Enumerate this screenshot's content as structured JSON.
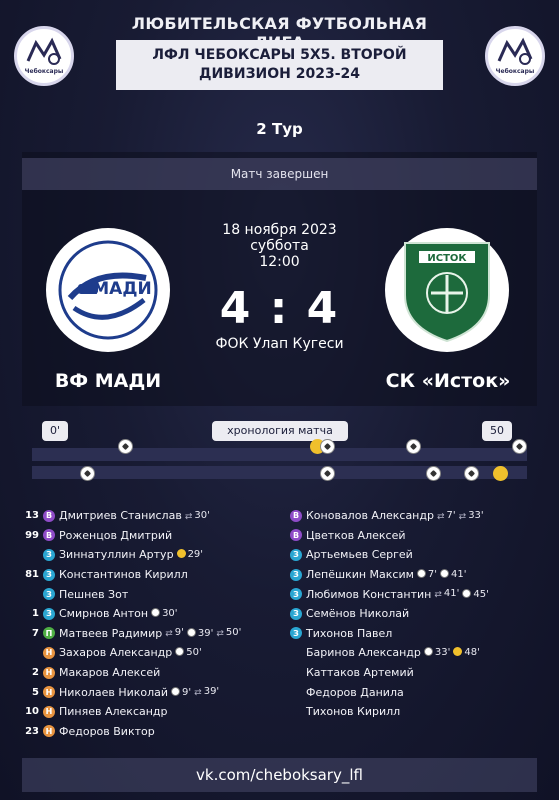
{
  "header": {
    "league_name": "ЛЮБИТЕЛЬСКАЯ ФУТБОЛЬНАЯ ЛИГА",
    "tournament_title": "ЛФЛ ЧЕБОКСАРЫ 5Х5. ВТОРОЙ ДИВИЗИОН 2023-24",
    "logo_city": "Чебоксары"
  },
  "round": "2 Тур",
  "match": {
    "status": "Матч завершен",
    "date": "18 ноября 2023",
    "weekday": "суббота",
    "time": "12:00",
    "score": "4 : 4",
    "venue": "ФОК Улап Кугеси",
    "home_team": "ВФ МАДИ",
    "away_team": "СК «Исток»",
    "home_logo_text": "МАДИ",
    "away_logo_text": "ИСТОК"
  },
  "timeline": {
    "start_label": "0'",
    "end_label": "50",
    "title": "хронология матча",
    "top_events": [
      {
        "minute": 9,
        "type": "goal"
      },
      {
        "minute": 29,
        "type": "yellow"
      },
      {
        "minute": 30,
        "type": "goal"
      },
      {
        "minute": 39,
        "type": "goal"
      },
      {
        "minute": 50,
        "type": "goal"
      }
    ],
    "bottom_events": [
      {
        "minute": 5,
        "type": "goal"
      },
      {
        "minute": 30,
        "type": "goal"
      },
      {
        "minute": 41,
        "type": "goal"
      },
      {
        "minute": 45,
        "type": "goal"
      },
      {
        "minute": 48,
        "type": "yellow"
      }
    ]
  },
  "home_players": [
    {
      "num": "13",
      "pos": "В",
      "name": "Дмитриев Станислав",
      "events": [
        {
          "icon": "sub",
          "text": "30'"
        }
      ]
    },
    {
      "num": "99",
      "pos": "В",
      "name": "Роженцов Дмитрий",
      "events": []
    },
    {
      "num": "",
      "pos": "З",
      "name": "Зиннатуллин Артур",
      "events": [
        {
          "icon": "yellow",
          "text": "29'"
        }
      ]
    },
    {
      "num": "81",
      "pos": "З",
      "name": "Константинов Кирилл",
      "events": []
    },
    {
      "num": "",
      "pos": "З",
      "name": "Пешнев Зот",
      "events": []
    },
    {
      "num": "1",
      "pos": "З",
      "name": "Смирнов Антон",
      "events": [
        {
          "icon": "goal",
          "text": "30'"
        }
      ]
    },
    {
      "num": "7",
      "pos": "П",
      "name": "Матвеев Радимир",
      "events": [
        {
          "icon": "sub",
          "text": "9'"
        },
        {
          "icon": "goal",
          "text": "39'"
        },
        {
          "icon": "sub",
          "text": "50'"
        }
      ]
    },
    {
      "num": "",
      "pos": "Н",
      "name": "Захаров Александр",
      "events": [
        {
          "icon": "goal",
          "text": "50'"
        }
      ]
    },
    {
      "num": "2",
      "pos": "Н",
      "name": "Макаров Алексей",
      "events": []
    },
    {
      "num": "5",
      "pos": "Н",
      "name": "Николаев Николай",
      "events": [
        {
          "icon": "goal",
          "text": "9'"
        },
        {
          "icon": "sub",
          "text": "39'"
        }
      ]
    },
    {
      "num": "10",
      "pos": "Н",
      "name": "Пиняев Александр",
      "events": []
    },
    {
      "num": "23",
      "pos": "Н",
      "name": "Федоров Виктор",
      "events": []
    }
  ],
  "away_players": [
    {
      "pos": "В",
      "name": "Коновалов Александр",
      "events": [
        {
          "icon": "sub",
          "text": "7'"
        },
        {
          "icon": "sub",
          "text": "33'"
        }
      ]
    },
    {
      "pos": "В",
      "name": "Цветков Алексей",
      "events": []
    },
    {
      "pos": "З",
      "name": "Артьемьев Сергей",
      "events": []
    },
    {
      "pos": "З",
      "name": "Лепёшкин Максим",
      "events": [
        {
          "icon": "goal",
          "text": "7'"
        },
        {
          "icon": "goal",
          "text": "41'"
        }
      ]
    },
    {
      "pos": "З",
      "name": "Любимов Константин",
      "events": [
        {
          "icon": "sub",
          "text": "41'"
        },
        {
          "icon": "goal",
          "text": "45'"
        }
      ]
    },
    {
      "pos": "З",
      "name": "Семёнов Николай",
      "events": []
    },
    {
      "pos": "З",
      "name": "Тихонов Павел",
      "events": []
    },
    {
      "pos": "",
      "name": "Баринов Александр",
      "events": [
        {
          "icon": "goal",
          "text": "33'"
        },
        {
          "icon": "yellow",
          "text": "48'"
        }
      ]
    },
    {
      "pos": "",
      "name": "Каттаков Артемий",
      "events": []
    },
    {
      "pos": "",
      "name": "Федоров Данила",
      "events": []
    },
    {
      "pos": "",
      "name": "Тихонов Кирилл",
      "events": []
    }
  ],
  "footer": {
    "link": "vk.com/cheboksary_lfl"
  },
  "colors": {
    "background": "#181b33",
    "title_box": "#ececf2",
    "pos_V": "#8f4cc8",
    "pos_Z": "#2aa6d2",
    "pos_P": "#4fae44",
    "pos_N": "#e89440",
    "yellow_card": "#f0c02c",
    "timeline_bar": "#2c2f52"
  }
}
